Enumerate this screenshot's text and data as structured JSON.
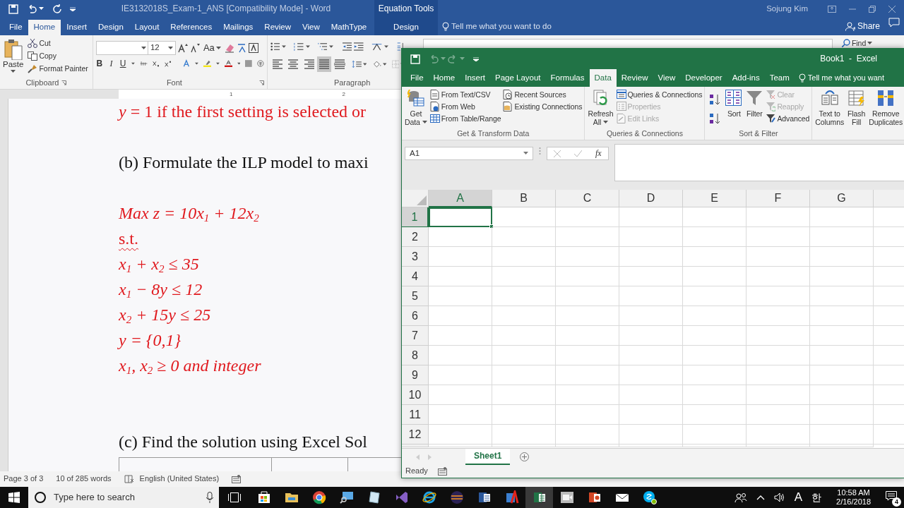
{
  "word": {
    "title": "IE3132018S_Exam-1_ANS [Compatibility Mode]  -  Word",
    "user": "Sojung Kim",
    "tabs": [
      {
        "label": "File",
        "selected": false
      },
      {
        "label": "Home",
        "selected": true
      },
      {
        "label": "Insert",
        "selected": false
      },
      {
        "label": "Design",
        "selected": false
      },
      {
        "label": "Layout",
        "selected": false
      },
      {
        "label": "References",
        "selected": false
      },
      {
        "label": "Mailings",
        "selected": false
      },
      {
        "label": "Review",
        "selected": false
      },
      {
        "label": "View",
        "selected": false
      },
      {
        "label": "MathType",
        "selected": false
      }
    ],
    "context_group": {
      "title": "Equation Tools",
      "tabs": [
        {
          "label": "Design",
          "selected": false
        }
      ]
    },
    "tell_me": "Tell me what you want to do",
    "share": "Share",
    "clipboard": {
      "paste": "Paste",
      "commands": [
        "Cut",
        "Copy",
        "Format Painter"
      ],
      "label": "Clipboard"
    },
    "font": {
      "size": "12",
      "format_buttons": [
        "B",
        "I",
        "U"
      ],
      "change_case": "Aa",
      "label": "Font"
    },
    "paragraph": {
      "alignments": [
        {
          "selected": false
        },
        {
          "selected": false
        },
        {
          "selected": false
        },
        {
          "selected": true
        },
        {
          "selected": false
        }
      ],
      "label": "Paragraph"
    },
    "find": "Find",
    "ruler_marks": [
      "1",
      "2"
    ],
    "document": [
      {
        "kind": "answer",
        "text": "*y* = 1 if the first setting is selected or",
        "flagged": false
      },
      {
        "kind": "blank"
      },
      {
        "kind": "question",
        "text": "(b) Formulate the ILP model to maxi",
        "flagged": false
      },
      {
        "kind": "blank"
      },
      {
        "kind": "math",
        "text": "Max z = 10x$_{1}$ + 12x$_{2}$",
        "flagged": false
      },
      {
        "kind": "answer",
        "text": "s.t.",
        "flagged": true
      },
      {
        "kind": "math",
        "text": "x$_{1}$ + x$_{2}$ ≤ 35",
        "flagged": false
      },
      {
        "kind": "math",
        "text": "x$_{1}$ − 8y ≤ 12",
        "flagged": false
      },
      {
        "kind": "math",
        "text": "x$_{2}$ + 15y ≤ 25",
        "flagged": false
      },
      {
        "kind": "math",
        "text": "y = {0,1}",
        "flagged": false
      },
      {
        "kind": "math",
        "text": "x$_{1}$, x$_{2}$ ≥ 0 and integer",
        "flagged": false
      },
      {
        "kind": "blank"
      },
      {
        "kind": "blank"
      },
      {
        "kind": "question",
        "text": "(c) Find the solution using Excel Sol",
        "flagged": false
      },
      {
        "kind": "table"
      }
    ],
    "status_bar": {
      "page": "Page 3 of 3",
      "words": "10 of 285 words",
      "language": "English (United States)"
    }
  },
  "excel": {
    "title": "Book1  -  Excel",
    "tabs": [
      {
        "label": "File",
        "selected": false
      },
      {
        "label": "Home",
        "selected": false
      },
      {
        "label": "Insert",
        "selected": false
      },
      {
        "label": "Page Layout",
        "selected": false
      },
      {
        "label": "Formulas",
        "selected": false
      },
      {
        "label": "Data",
        "selected": true
      },
      {
        "label": "Review",
        "selected": false
      },
      {
        "label": "View",
        "selected": false
      },
      {
        "label": "Developer",
        "selected": false
      },
      {
        "label": "Add-ins",
        "selected": false
      },
      {
        "label": "Team",
        "selected": false
      }
    ],
    "tell_me": "Tell me what you want",
    "ribbon_groups": [
      {
        "label": "Get & Transform Data",
        "items": [
          {
            "kind": "large",
            "lines": [
              "Get",
              "Data"
            ],
            "menu": true,
            "disabled": false
          },
          {
            "kind": "column",
            "buttons": [
              {
                "label": "From Text/CSV",
                "disabled": false
              },
              {
                "label": "From Web",
                "disabled": false
              },
              {
                "label": "From Table/Range",
                "disabled": false
              }
            ]
          },
          {
            "kind": "column",
            "buttons": [
              {
                "label": "Recent Sources",
                "disabled": false
              },
              {
                "label": "Existing Connections",
                "disabled": false
              }
            ]
          }
        ]
      },
      {
        "label": "Queries & Connections",
        "items": [
          {
            "kind": "large",
            "lines": [
              "Refresh",
              "All"
            ],
            "menu": true,
            "disabled": false
          },
          {
            "kind": "column",
            "buttons": [
              {
                "label": "Queries & Connections",
                "disabled": false
              },
              {
                "label": "Properties",
                "disabled": true
              },
              {
                "label": "Edit Links",
                "disabled": true
              }
            ]
          }
        ]
      },
      {
        "label": "Sort & Filter",
        "items": [
          {
            "kind": "sort_pair"
          },
          {
            "kind": "large",
            "lines": [
              "Sort"
            ],
            "menu": false,
            "disabled": false
          },
          {
            "kind": "large",
            "lines": [
              "Filter"
            ],
            "menu": false,
            "disabled": false
          },
          {
            "kind": "column",
            "buttons": [
              {
                "label": "Clear",
                "disabled": true
              },
              {
                "label": "Reapply",
                "disabled": true
              },
              {
                "label": "Advanced",
                "disabled": false
              }
            ]
          }
        ]
      },
      {
        "items": [
          {
            "kind": "large",
            "lines": [
              "Text to",
              "Columns"
            ],
            "menu": false,
            "disabled": false
          },
          {
            "kind": "large",
            "lines": [
              "Flash",
              "Fill"
            ],
            "menu": false,
            "disabled": false
          },
          {
            "kind": "large",
            "lines": [
              "Remove",
              "Duplicates"
            ],
            "menu": false,
            "disabled": false
          }
        ]
      }
    ],
    "name_box": "A1",
    "function_label": "fx",
    "columns": [
      {
        "label": "A",
        "selected": true
      },
      {
        "label": "B",
        "selected": false
      },
      {
        "label": "C",
        "selected": false
      },
      {
        "label": "D",
        "selected": false
      },
      {
        "label": "E",
        "selected": false
      },
      {
        "label": "F",
        "selected": false
      },
      {
        "label": "G",
        "selected": false
      }
    ],
    "rows": [
      {
        "label": "1",
        "selected": true
      },
      {
        "label": "2",
        "selected": false
      },
      {
        "label": "3",
        "selected": false
      },
      {
        "label": "4",
        "selected": false
      },
      {
        "label": "5",
        "selected": false
      },
      {
        "label": "6",
        "selected": false
      },
      {
        "label": "7",
        "selected": false
      },
      {
        "label": "8",
        "selected": false
      },
      {
        "label": "9",
        "selected": false
      },
      {
        "label": "10",
        "selected": false
      },
      {
        "label": "11",
        "selected": false
      },
      {
        "label": "12",
        "selected": false
      }
    ],
    "sheets": [
      {
        "label": "Sheet1",
        "selected": true
      }
    ],
    "status": "Ready"
  },
  "taskbar": {
    "search_placeholder": "Type here to search",
    "apps": [
      {
        "kind": "store",
        "active": false
      },
      {
        "kind": "folder",
        "active": false
      },
      {
        "kind": "chrome",
        "active": false
      },
      {
        "kind": "remote",
        "active": false
      },
      {
        "kind": "notepad",
        "active": false
      },
      {
        "kind": "studio",
        "active": false
      },
      {
        "kind": "ie",
        "active": false
      },
      {
        "kind": "eclipse",
        "active": false
      },
      {
        "kind": "word",
        "active": false
      },
      {
        "kind": "acrobat",
        "active": false
      },
      {
        "kind": "excel",
        "active": true
      },
      {
        "kind": "video",
        "active": false
      },
      {
        "kind": "powerpoint",
        "active": false
      },
      {
        "kind": "mail",
        "active": false
      },
      {
        "kind": "skype",
        "active": false
      }
    ],
    "input_indicator": "A",
    "ime": "한",
    "time": "10:58 AM",
    "date": "2/16/2018",
    "notification_count": "4"
  }
}
